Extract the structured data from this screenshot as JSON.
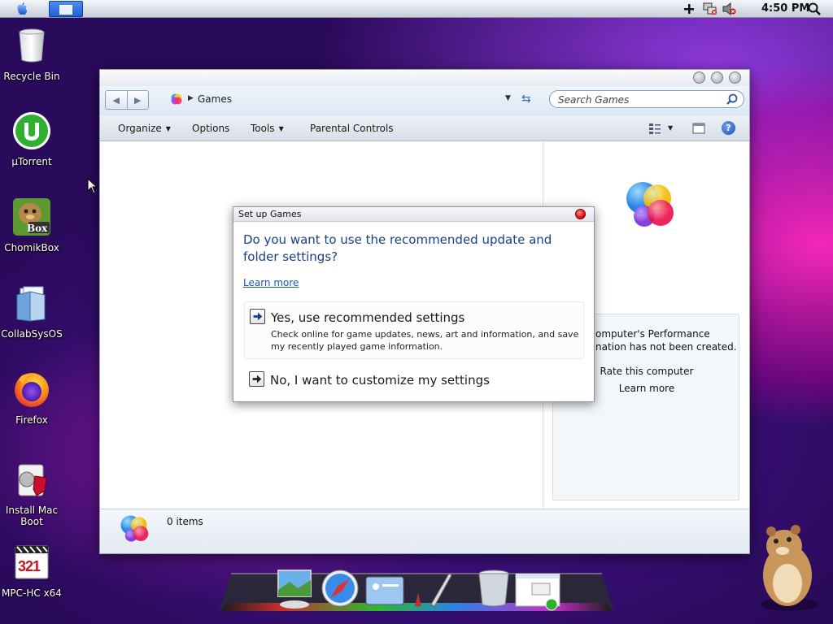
{
  "menubar": {
    "clock": "4:50 PM"
  },
  "desktop": {
    "icons": [
      {
        "label": "Recycle Bin"
      },
      {
        "label": "µTorrent"
      },
      {
        "label": "ChomikBox"
      },
      {
        "label": "CollabSysOS"
      },
      {
        "label": "Firefox"
      },
      {
        "label": "Install Mac Boot"
      },
      {
        "label": "MPC-HC x64"
      }
    ],
    "chomik_badge": "Box",
    "mpc_badge": "321"
  },
  "window": {
    "breadcrumb": "Games",
    "search_placeholder": "Search Games",
    "toolbar": {
      "organize": "Organize",
      "options": "Options",
      "tools": "Tools",
      "parental_controls": "Parental Controls"
    },
    "help_label": "?",
    "perf_panel": {
      "line1": "omputer's Performance",
      "line2": "nation has not been created.",
      "rate": "Rate this computer",
      "learn_more": "Learn more"
    },
    "status": {
      "items": "0 items"
    }
  },
  "dialog": {
    "title": "Set up Games",
    "question": "Do you want to use the recommended update and folder settings?",
    "learn_more": "Learn more",
    "option_yes": {
      "title": "Yes, use recommended settings",
      "description": "Check online for game updates, news, art and information, and save my recently played game information."
    },
    "option_no": {
      "title": "No, I want to customize my settings"
    }
  },
  "colors": {
    "link": "#1a55c0",
    "heading": "#1a3f8a",
    "close": "#e01010"
  }
}
